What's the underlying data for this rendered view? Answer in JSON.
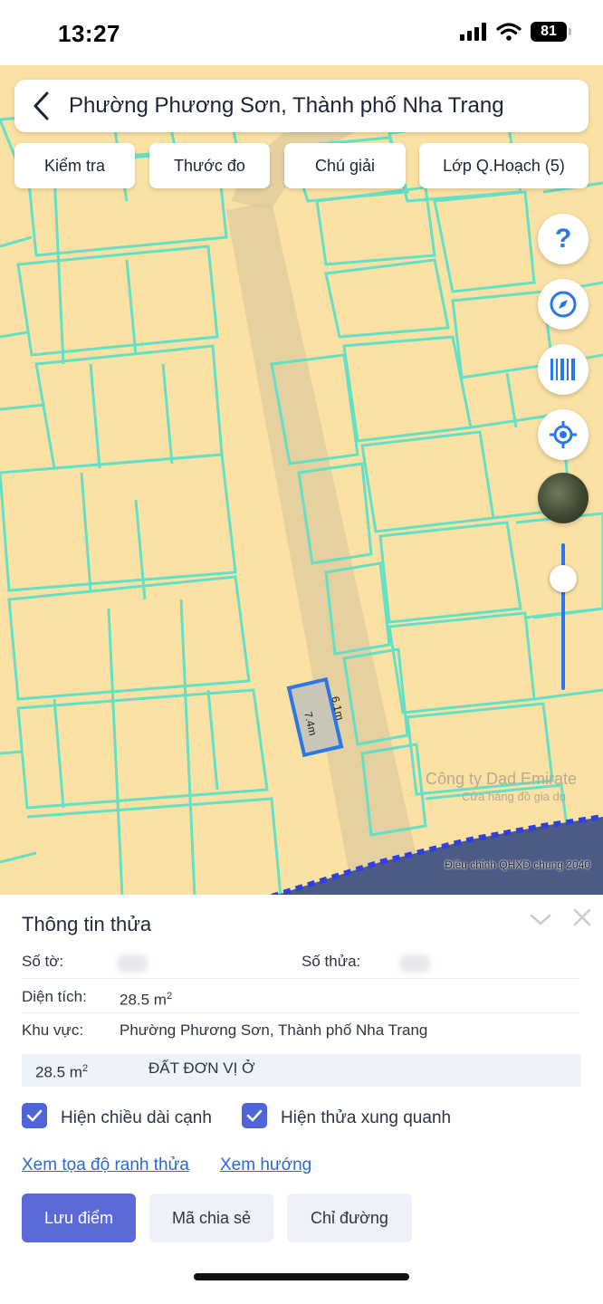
{
  "status": {
    "time": "13:27",
    "battery": "81"
  },
  "header": {
    "title": "Phường Phương Sơn, Thành phố Nha Trang"
  },
  "chips": [
    {
      "label": "Kiểm tra"
    },
    {
      "label": "Thước đo"
    },
    {
      "label": "Chú giải"
    },
    {
      "label": "Lớp Q.Hoạch (5)"
    }
  ],
  "map": {
    "edge_label_top": "6.1m",
    "edge_label_left": "7.4m",
    "store_label": "Công ty Dad Emirate",
    "store_sub": "Cửa hàng đồ gia dụ",
    "caption": "Điều chỉnh QHXD chung 2040",
    "colors": {
      "land": "#fbe2a4",
      "boundary": "#5ce0c8",
      "selection": "#2a77e8",
      "road": "#dccb9e"
    },
    "zoom_level": 0.85
  },
  "sheet": {
    "title": "Thông tin thửa",
    "so_to_label": "Số tờ:",
    "so_thua_label": "Số thửa:",
    "dien_tich_label": "Diện tích:",
    "dien_tich_value": "28.5 m",
    "dien_tich_unit_sup": "2",
    "khu_vuc_label": "Khu vực:",
    "khu_vuc_value": "Phường Phương Sơn, Thành phố Nha Trang",
    "landuse": {
      "area": "28.5 m",
      "area_sup": "2",
      "type": "ĐẤT ĐƠN VỊ Ở"
    },
    "checkbox_edges": {
      "label": "Hiện chiều dài cạnh",
      "checked": true
    },
    "checkbox_neighbors": {
      "label": "Hiện thửa xung quanh",
      "checked": true
    },
    "link_coords": "Xem tọa độ ranh thửa",
    "link_direction": "Xem hướng",
    "btn_save": "Lưu điểm",
    "btn_share": "Mã chia sẻ",
    "btn_route": "Chỉ đường"
  }
}
